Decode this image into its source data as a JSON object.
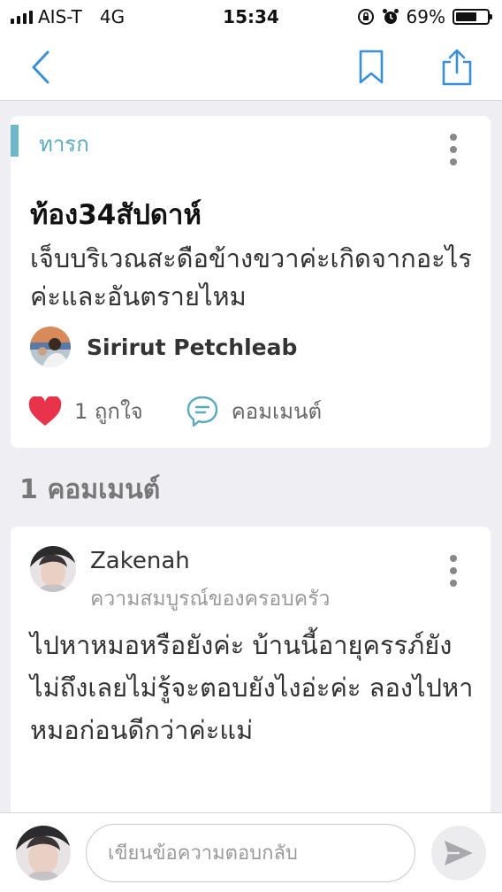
{
  "status_bar": {
    "carrier": "AIS-T",
    "network": "4G",
    "time": "15:34",
    "battery": "69%",
    "battery_level": 0.69,
    "icons": [
      "signal-icon",
      "rotation-lock-icon",
      "alarm-icon",
      "battery-icon"
    ]
  },
  "nav": {
    "icons": [
      "back-chevron-icon",
      "bookmark-icon",
      "share-icon"
    ],
    "accent_color": "#3a8fd9"
  },
  "post": {
    "tag": "ทารก",
    "tag_color": "#5aa9bd",
    "title": "ท้อง34สัปดาห์",
    "body": "เจ็บบริเวณสะดือข้างขวาค่ะเกิดจากอะไรค่ะและอันตรายไหม",
    "author": "Sirirut Petchleab",
    "likes_label": "1 ถูกใจ",
    "comment_label": "คอมเมนต์",
    "like_color": "#e8334a"
  },
  "comments_header": "1 คอมเมนต์",
  "comment": {
    "name": "Zakenah",
    "subtitle": "ความสมบูรณ์ของครอบครัว",
    "body": "ไปหาหมอหรือยังค่ะ บ้านนี้อายุครรภ์ยังไม่ถึงเลยไม่รู้จะตอบยังไงอ่ะค่ะ ลองไปหาหมอก่อนดีกว่าค่ะแม่"
  },
  "reply": {
    "placeholder": "เขียนข้อความตอบกลับ"
  }
}
